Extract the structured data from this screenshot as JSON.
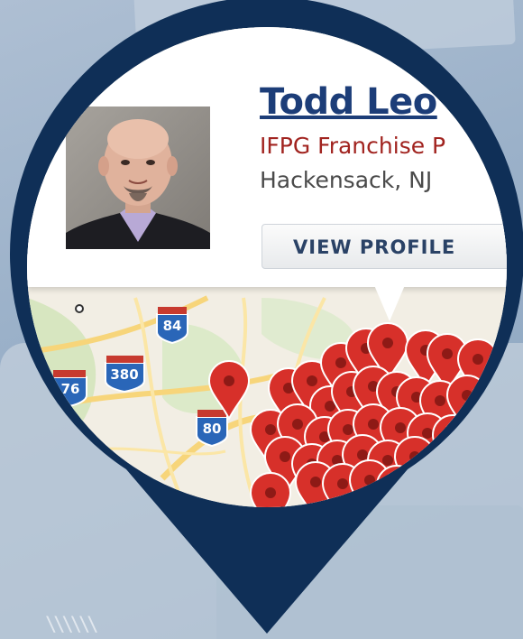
{
  "profile_card": {
    "name": "Todd Leo",
    "title": "IFPG Franchise P",
    "location": "Hackensack, NJ",
    "view_profile_label": "VIEW PROFILE"
  },
  "map": {
    "highway_shields": [
      "84",
      "380",
      "76",
      "80"
    ]
  },
  "colors": {
    "pin_navy": "#0f2f57",
    "marker_red": "#d7302a",
    "name_blue": "#1c3d78",
    "title_red": "#a1231f"
  }
}
